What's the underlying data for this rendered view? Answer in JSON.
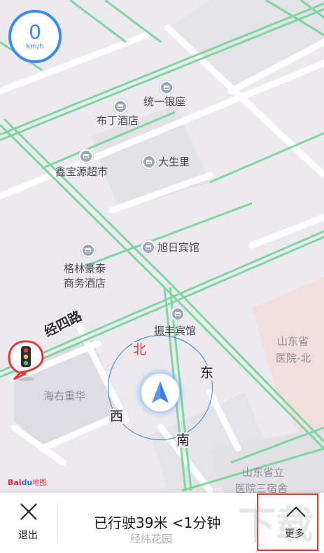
{
  "speed": {
    "value": "0",
    "unit": "km/h"
  },
  "map": {
    "road_name": "经四路",
    "pois": [
      {
        "name": "统一银座"
      },
      {
        "name": "布丁酒店"
      },
      {
        "name": "鑫宝源超市"
      },
      {
        "name": "大生里"
      },
      {
        "name": "旭日宾馆"
      },
      {
        "name": "格林豪泰",
        "line2": "商务酒店"
      },
      {
        "name": "振丰宾馆"
      }
    ],
    "regions": [
      {
        "name": "山东省"
      },
      {
        "name": "医院-北"
      },
      {
        "name": "海右重华"
      },
      {
        "name": "山东省立"
      },
      {
        "name": "医院三宿舍"
      },
      {
        "name": "经纬花园"
      }
    ]
  },
  "compass": {
    "north": "北",
    "east": "东",
    "south": "南",
    "west": "西"
  },
  "logo": {
    "brand": "Bai",
    "ditu": "地图"
  },
  "bottom_bar": {
    "exit_label": "退出",
    "trip_info": "已行驶39米 <1分钟",
    "more_label": "更多"
  },
  "watermark": "下载",
  "colors": {
    "accent": "#3d8af7",
    "road_green": "#7ed6a0",
    "highlight_border": "#e23b3b",
    "hospital_block": "#f3dede"
  }
}
